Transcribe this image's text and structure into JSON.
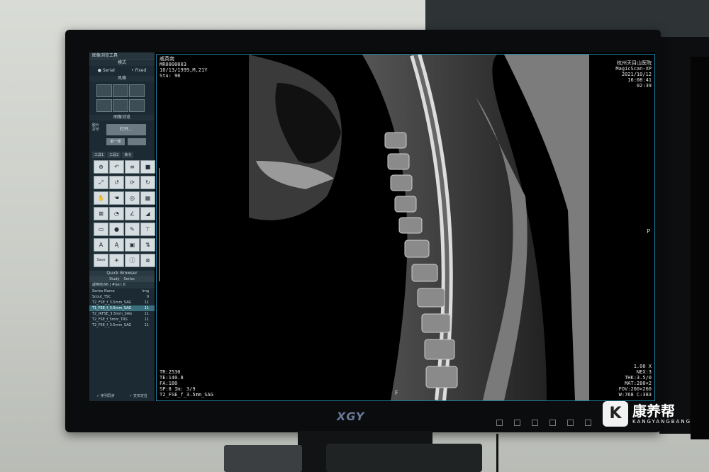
{
  "panel": {
    "title": "图像浏览工具",
    "mode_label": "模式",
    "mode_serial": "Serial",
    "mode_fixed": "Fixed",
    "layout_label": "风格",
    "browse_label": "图像浏览",
    "open_button": "打开...",
    "prev_button": "前一张",
    "film_label": "胶片打印",
    "tab1": "工具1",
    "tab2": "工具2",
    "tab3": "命令",
    "save_label": "Save",
    "quick_browser": "Quick Browser",
    "qb_tab_study": "Study",
    "qb_tab_series": "Series",
    "patient_row": "戚英南/96 | #Ser: 6",
    "series_header": [
      "Series Name",
      "Img"
    ],
    "series": [
      {
        "name": "Scout_TSC",
        "img": "9"
      },
      {
        "name": "T2_FSE_f_3.5mm_SAG",
        "img": "11"
      },
      {
        "name": "T1_FSE_f_3.5mm_SAG",
        "img": "11"
      },
      {
        "name": "T2_IRFSE_3.5mm_SAG",
        "img": "11"
      },
      {
        "name": "T2_FSE_f_5mm_TRS",
        "img": "11"
      },
      {
        "name": "T2_FSE_f_3.5mm_SAG",
        "img": "11"
      }
    ],
    "foot_sync": "序列同步",
    "foot_cross": "交叉定位"
  },
  "overlay": {
    "top_left": [
      "戚英南",
      "MR0000003",
      "10/13/1999,M,21Y",
      "Stu: 96"
    ],
    "top_right": [
      "杭州天目山医院",
      "MagicScan-XP",
      "2021/10/12",
      "16:08:41",
      "02:39"
    ],
    "bottom_left": [
      "TR:2530",
      "TE:140.8",
      "FA:180",
      "SP:8 Im: 3/9",
      "T2_FSE_f_3.5mm_SAG"
    ],
    "bottom_right": [
      "1.00 X",
      "NEX:3",
      "THK:3.5/0",
      "MAT:280×2",
      "FOV:260×260",
      "W:768 C:383"
    ],
    "orient_right": "P",
    "orient_bottom": "F"
  },
  "monitor": {
    "brand": "XGY"
  },
  "watermark": {
    "text": "康养帮",
    "sub": "KANGYANGBANG"
  }
}
